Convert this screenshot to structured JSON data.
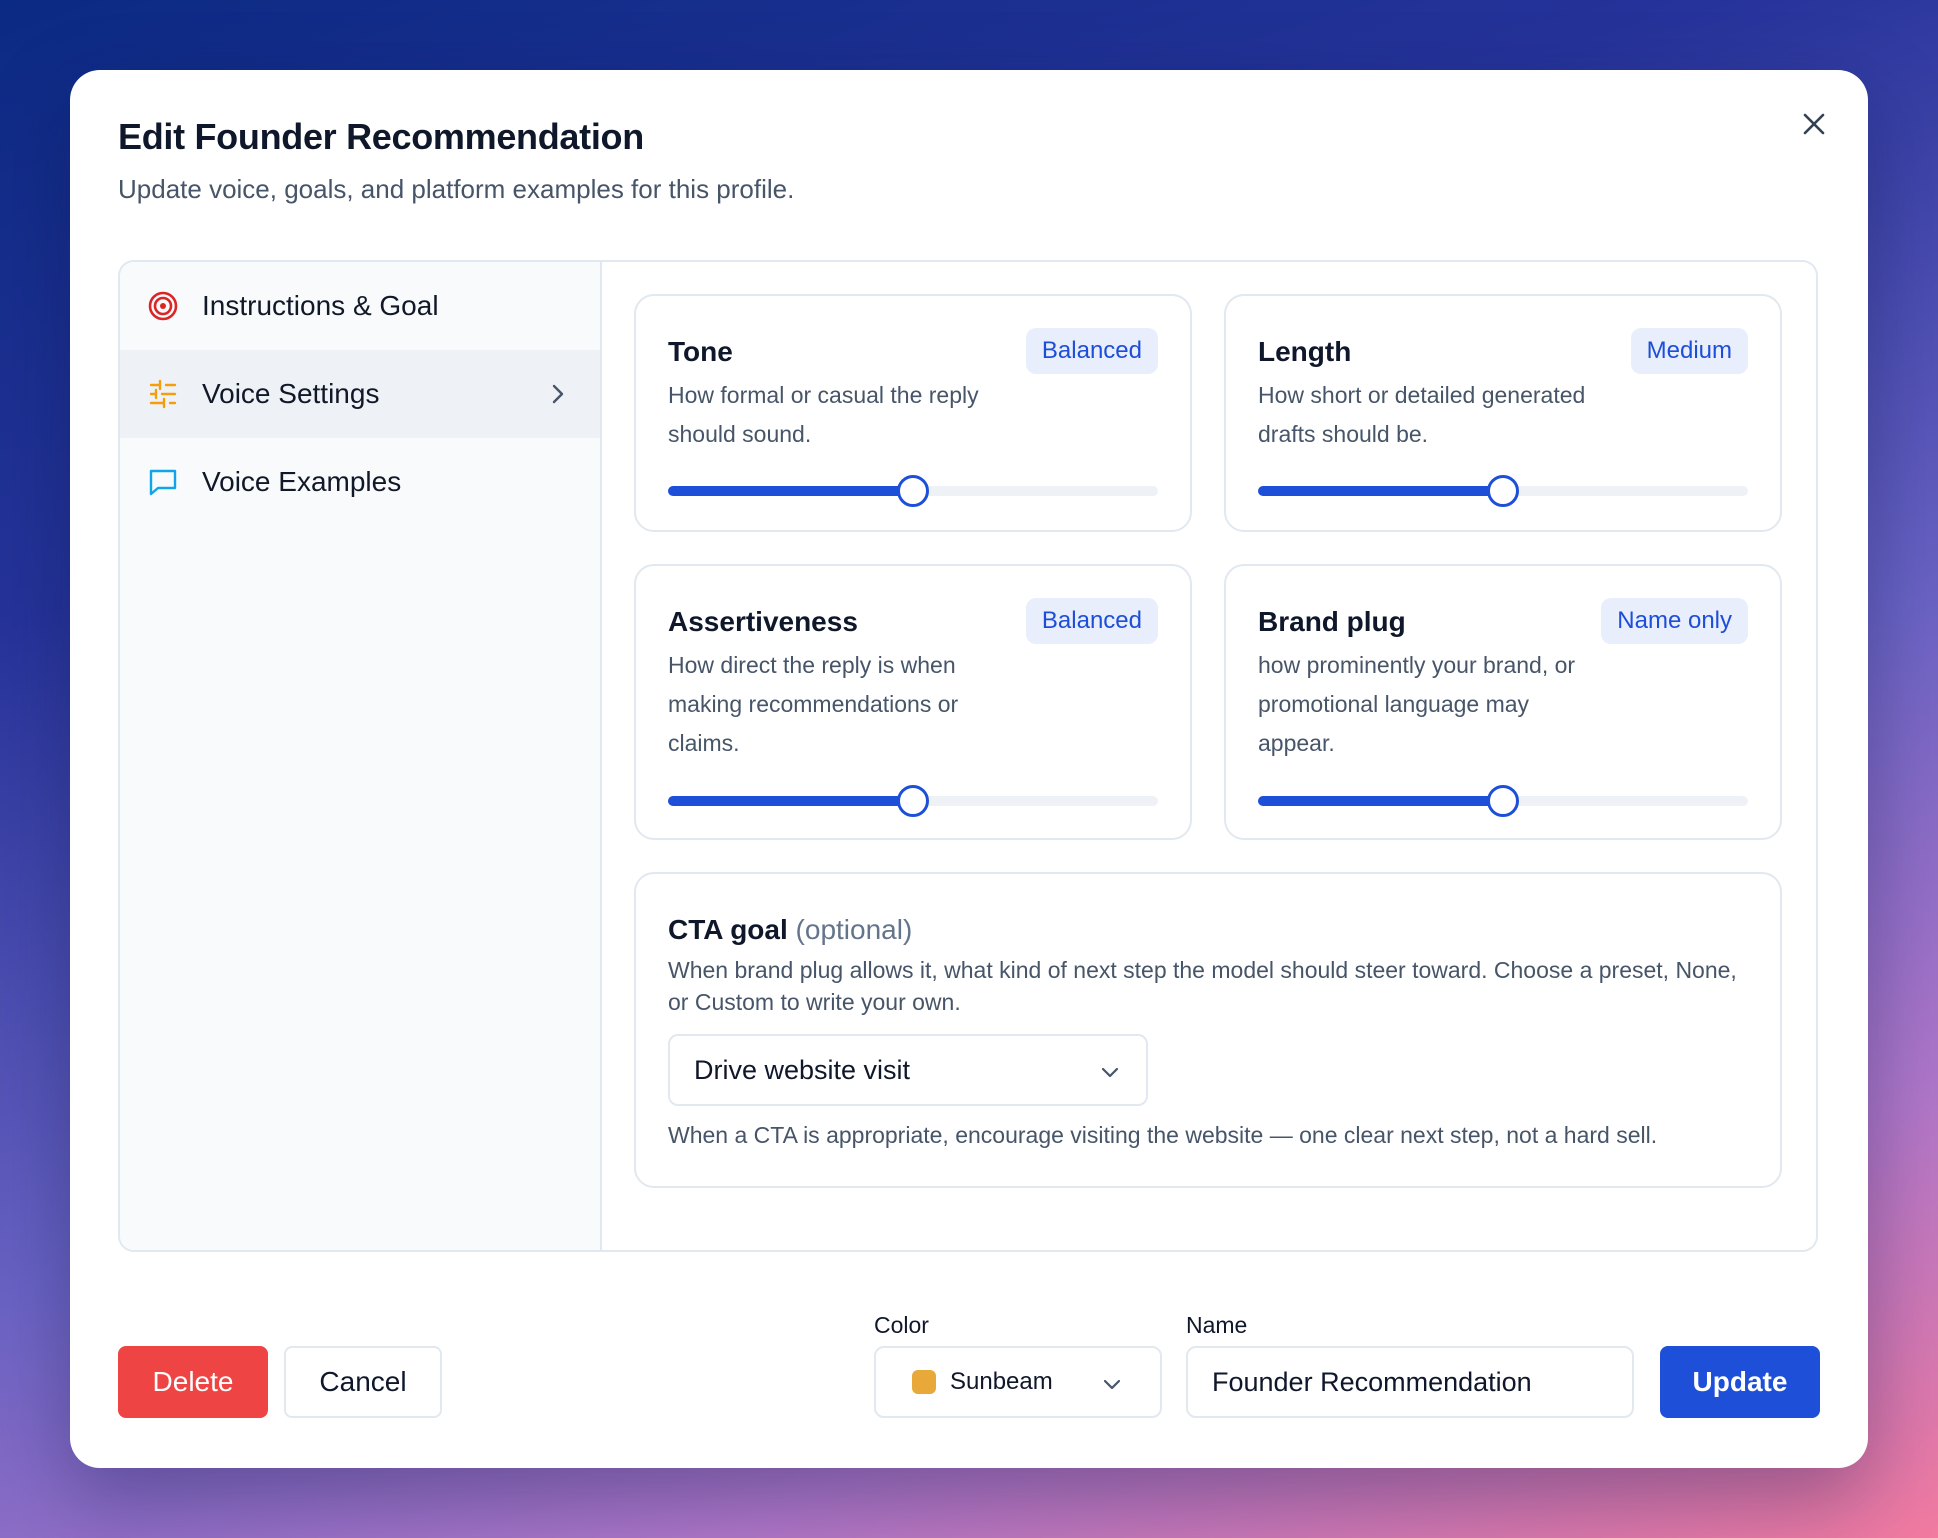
{
  "modal": {
    "title": "Edit Founder Recommendation",
    "subtitle": "Update voice, goals, and platform examples for this profile."
  },
  "sidebar": {
    "items": [
      {
        "label": "Instructions & Goal",
        "icon": "target-icon",
        "icon_color": "#dc2626"
      },
      {
        "label": "Voice Settings",
        "icon": "sliders-icon",
        "icon_color": "#f59e0b",
        "active": true
      },
      {
        "label": "Voice Examples",
        "icon": "chat-bubble-icon",
        "icon_color": "#0ea5e9"
      }
    ]
  },
  "settings": [
    {
      "title": "Tone",
      "badge": "Balanced",
      "description": "How formal or casual the reply should sound.",
      "level_percent": 50
    },
    {
      "title": "Length",
      "badge": "Medium",
      "description": "How short or detailed generated drafts should be.",
      "level_percent": 50
    },
    {
      "title": "Assertiveness",
      "badge": "Balanced",
      "description": "How direct the reply is when making recommendations or claims.",
      "level_percent": 50
    },
    {
      "title": "Brand plug",
      "badge": "Name only",
      "description": "how prominently your brand, or promotional language may appear.",
      "level_percent": 50
    }
  ],
  "cta": {
    "title": "CTA goal",
    "optional": "(optional)",
    "description": "When brand plug allows it, what kind of next step the model should steer toward. Choose a preset, None, or Custom to write your own.",
    "selected": "Drive website visit",
    "help": "When a CTA is appropriate, encourage visiting the website — one clear next step, not a hard sell."
  },
  "footer": {
    "delete_label": "Delete",
    "cancel_label": "Cancel",
    "color_label": "Color",
    "color_value": "Sunbeam",
    "color_swatch": "#e8a93a",
    "name_label": "Name",
    "name_value": "Founder Recommendation",
    "update_label": "Update"
  },
  "colors": {
    "accent": "#1d4fd8",
    "danger": "#ef4444",
    "badge_bg": "#e8eefb"
  }
}
